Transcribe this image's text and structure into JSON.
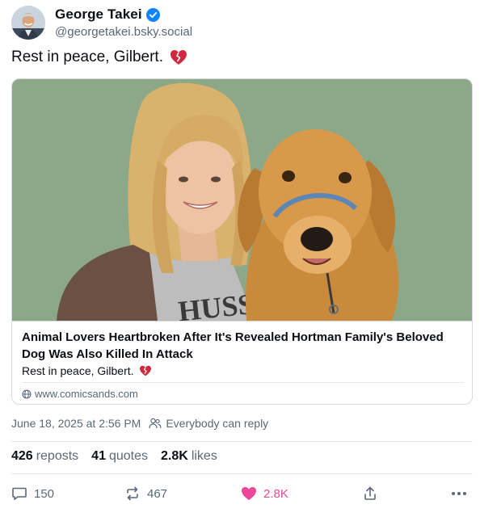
{
  "author": {
    "display_name": "George Takei",
    "handle": "@georgetakei.bsky.social",
    "verified": true
  },
  "post": {
    "text": "Rest in peace, Gilbert.",
    "emoji": "broken-heart-icon"
  },
  "embed": {
    "image_alt": "Woman with blonde hair smiling next to a golden retriever wearing a blue halter",
    "title": "Animal Lovers Heartbroken After It's Revealed Hortman Family's Beloved Dog Was Also Killed In Attack",
    "description": "Rest in peace, Gilbert.",
    "domain": "www.comicsands.com",
    "shirt_text": "HUSS"
  },
  "meta": {
    "timestamp": "June 18, 2025 at 2:56 PM",
    "reply_setting": "Everybody can reply"
  },
  "stats": {
    "reposts_count": "426",
    "reposts_label": "reposts",
    "quotes_count": "41",
    "quotes_label": "quotes",
    "likes_count": "2.8K",
    "likes_label": "likes"
  },
  "actions": {
    "reply_count": "150",
    "repost_count": "467",
    "like_count": "2.8K"
  },
  "colors": {
    "accent": "#1083fe",
    "like": "#ec4899",
    "muted": "#5a6776",
    "heart": "#d0283c"
  }
}
